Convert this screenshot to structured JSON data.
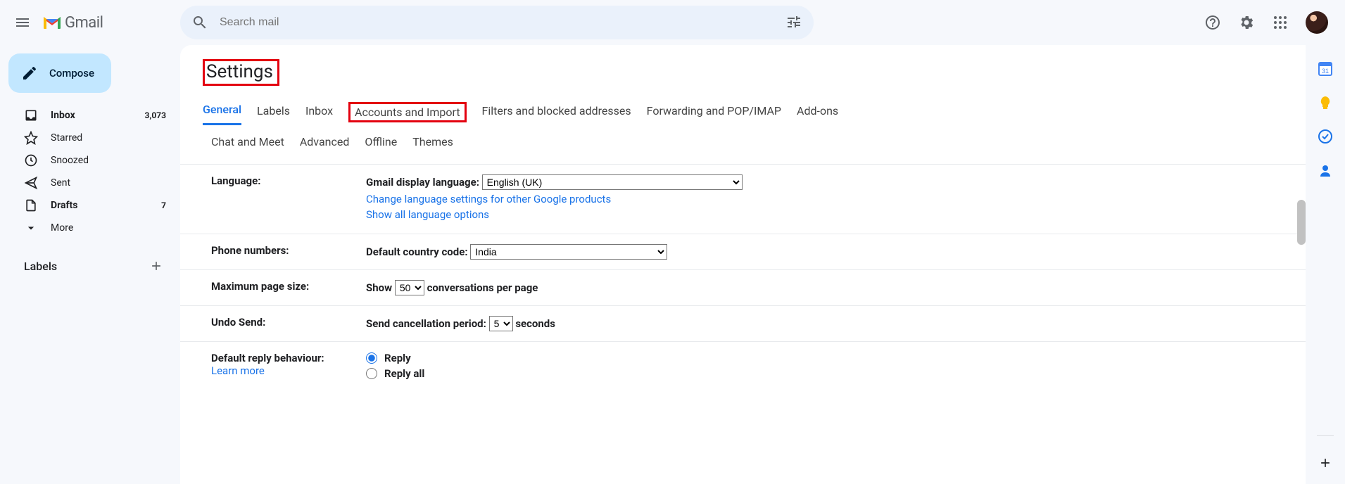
{
  "header": {
    "brand": "Gmail",
    "search_placeholder": "Search mail"
  },
  "sidebar": {
    "compose_label": "Compose",
    "items": [
      {
        "label": "Inbox",
        "count": "3,073",
        "bold": true
      },
      {
        "label": "Starred",
        "count": ""
      },
      {
        "label": "Snoozed",
        "count": ""
      },
      {
        "label": "Sent",
        "count": ""
      },
      {
        "label": "Drafts",
        "count": "7",
        "bold": true
      },
      {
        "label": "More",
        "count": ""
      }
    ],
    "labels_header": "Labels"
  },
  "settings": {
    "title": "Settings",
    "tabs_row1": [
      "General",
      "Labels",
      "Inbox",
      "Accounts and Import",
      "Filters and blocked addresses",
      "Forwarding and POP/IMAP",
      "Add-ons"
    ],
    "tabs_row2": [
      "Chat and Meet",
      "Advanced",
      "Offline",
      "Themes"
    ],
    "language": {
      "label": "Language:",
      "display_label": "Gmail display language:",
      "selected": "English (UK)",
      "change_link": "Change language settings for other Google products",
      "show_all_link": "Show all language options"
    },
    "phone": {
      "label": "Phone numbers:",
      "code_label": "Default country code:",
      "selected": "India"
    },
    "page_size": {
      "label": "Maximum page size:",
      "show": "Show",
      "value": "50",
      "suffix": "conversations per page"
    },
    "undo": {
      "label": "Undo Send:",
      "prefix": "Send cancellation period:",
      "value": "5",
      "suffix": "seconds"
    },
    "reply": {
      "label": "Default reply behaviour:",
      "learn_more": "Learn more",
      "opt_reply": "Reply",
      "opt_reply_all": "Reply all"
    }
  }
}
